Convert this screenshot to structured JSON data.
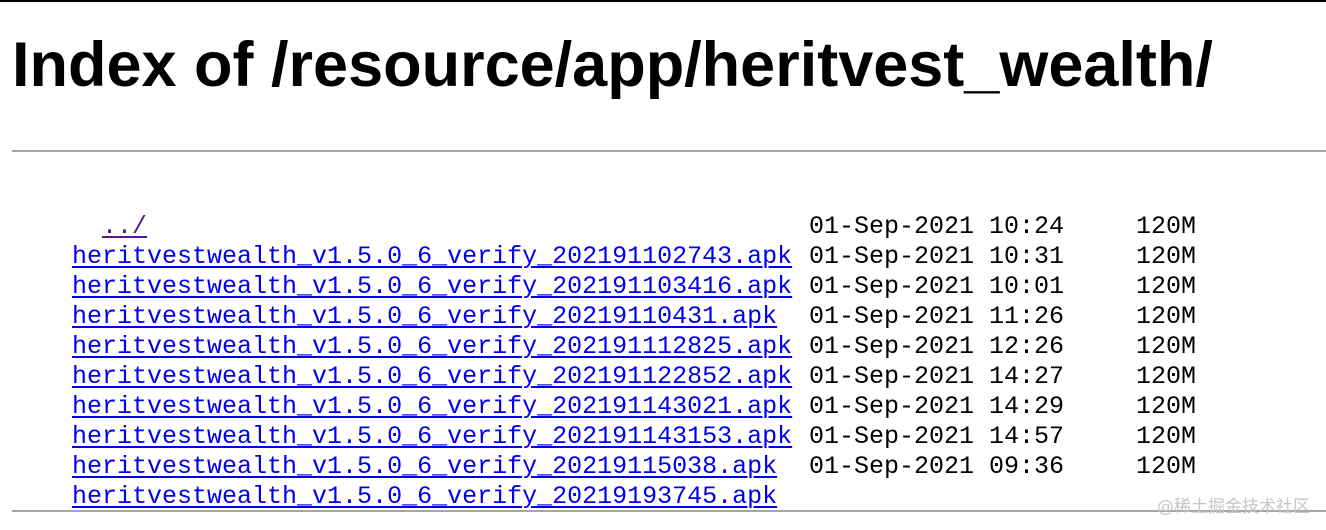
{
  "page": {
    "title": "Index of /resource/app/heritvest_wealth/",
    "parent_link": "../"
  },
  "files": [
    {
      "name": "heritvestwealth_v1.5.0_6_verify_202191102743.apk",
      "date": "01-Sep-2021 10:24",
      "size": "120M"
    },
    {
      "name": "heritvestwealth_v1.5.0_6_verify_202191103416.apk",
      "date": "01-Sep-2021 10:31",
      "size": "120M"
    },
    {
      "name": "heritvestwealth_v1.5.0_6_verify_20219110431.apk",
      "date": "01-Sep-2021 10:01",
      "size": "120M"
    },
    {
      "name": "heritvestwealth_v1.5.0_6_verify_202191112825.apk",
      "date": "01-Sep-2021 11:26",
      "size": "120M"
    },
    {
      "name": "heritvestwealth_v1.5.0_6_verify_202191122852.apk",
      "date": "01-Sep-2021 12:26",
      "size": "120M"
    },
    {
      "name": "heritvestwealth_v1.5.0_6_verify_202191143021.apk",
      "date": "01-Sep-2021 14:27",
      "size": "120M"
    },
    {
      "name": "heritvestwealth_v1.5.0_6_verify_202191143153.apk",
      "date": "01-Sep-2021 14:29",
      "size": "120M"
    },
    {
      "name": "heritvestwealth_v1.5.0_6_verify_20219115038.apk",
      "date": "01-Sep-2021 14:57",
      "size": "120M"
    },
    {
      "name": "heritvestwealth_v1.5.0_6_verify_20219193745.apk",
      "date": "01-Sep-2021 09:36",
      "size": "120M"
    }
  ],
  "watermark": "@稀土掘金技术社区",
  "colors": {
    "link": "#0000ee",
    "visited_link": "#551a8b",
    "rule": "#a6a6a6",
    "watermark": "#c6c6c6"
  }
}
